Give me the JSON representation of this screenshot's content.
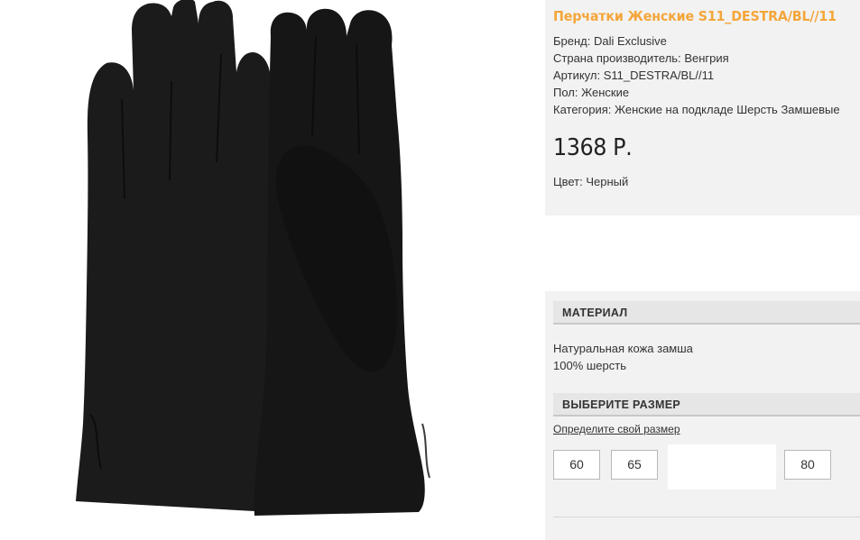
{
  "product": {
    "title": "Перчатки Женские S11_DESTRA/BL//11",
    "attributes": [
      {
        "label": "Бренд:",
        "value": "Dali Exclusive"
      },
      {
        "label": "Страна производитель:",
        "value": "Венгрия"
      },
      {
        "label": "Артикул:",
        "value": "S11_DESTRA/BL//11"
      },
      {
        "label": "Пол:",
        "value": "Женские"
      },
      {
        "label": "Категория:",
        "value": "Женские на подкладе Шерсть Замшевые"
      }
    ],
    "price": "1368 Р.",
    "color": {
      "label": "Цвет:",
      "value": "Черный"
    }
  },
  "material": {
    "heading": "МАТЕРИАЛ",
    "lines": [
      "Натуральная кожа замша",
      "100% шерсть"
    ]
  },
  "size": {
    "heading": "ВЫБЕРИТЕ РАЗМЕР",
    "link": "Определите свой размер",
    "options": [
      "60",
      "65",
      "80"
    ]
  },
  "colors": {
    "title": "#f4a63a",
    "panel_bg": "#f2f2f2",
    "section_bg": "#e6e6e6",
    "glove": "#1b1b1b"
  }
}
